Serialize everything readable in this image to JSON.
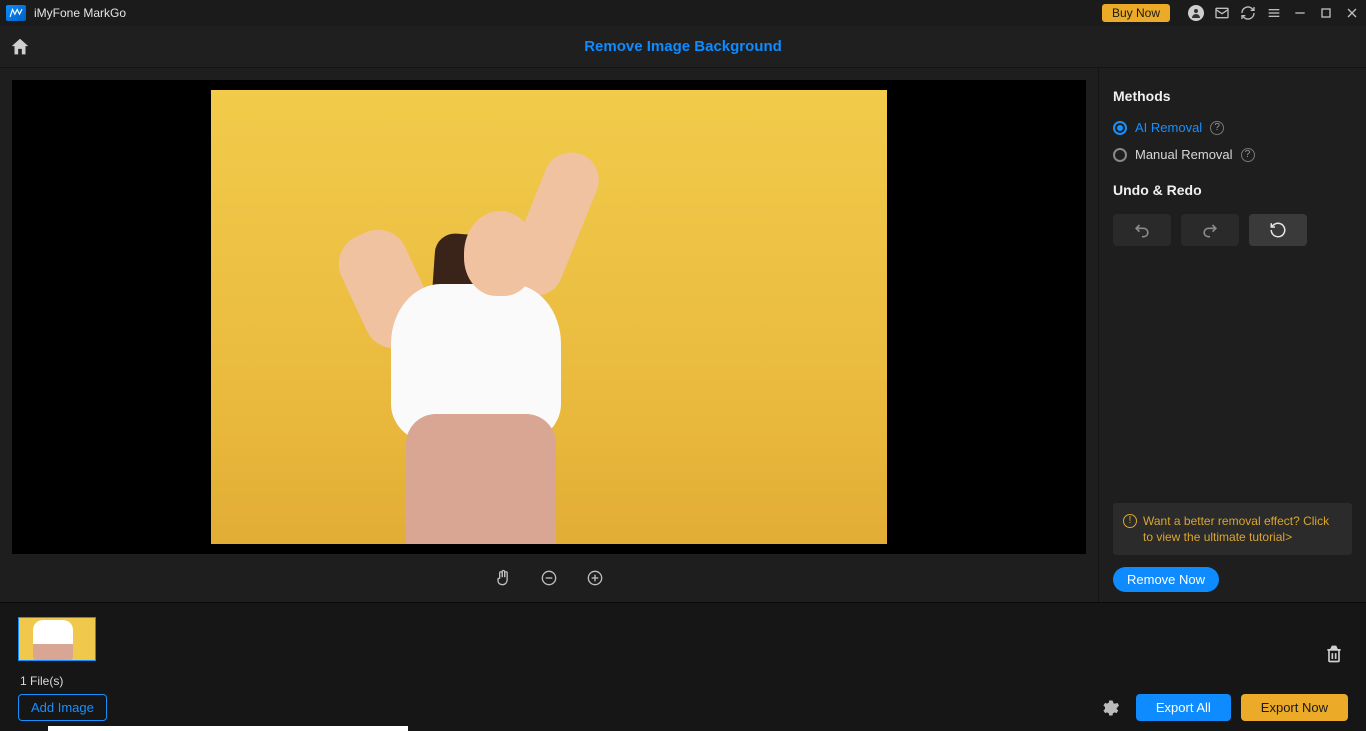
{
  "titlebar": {
    "app_name": "iMyFone MarkGo",
    "buy_now": "Buy Now"
  },
  "header": {
    "page_title": "Remove Image Background"
  },
  "panel": {
    "methods_title": "Methods",
    "ai_removal": "AI Removal",
    "manual_removal": "Manual Removal",
    "undo_redo_title": "Undo & Redo",
    "tip_text": "Want a better removal effect? Click to view the ultimate tutorial>",
    "remove_now": "Remove Now"
  },
  "bottom": {
    "file_count": "1 File(s)",
    "add_image": "Add Image",
    "export_all": "Export All",
    "export_now": "Export Now"
  }
}
